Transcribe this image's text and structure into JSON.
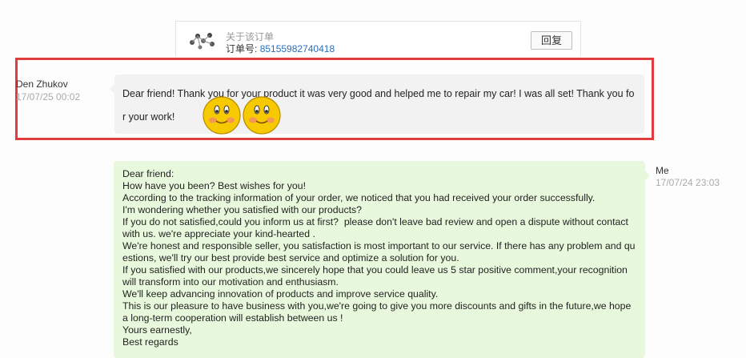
{
  "order": {
    "about_label": "关于该订单",
    "order_no_label": "订单号:",
    "order_no_value": "8515598274041 8",
    "reply_label": "回复"
  },
  "incoming": {
    "sender": "Den Zhukov",
    "time": "17/07/25 00:02",
    "text": "Dear friend! Thank you for your product it was very good and helped me to repair my car! I was all set! Thank you for your work!",
    "emoji": [
      "smiley-face",
      "smiley-face"
    ]
  },
  "outgoing": {
    "sender": "Me",
    "time": "17/07/24 23:03",
    "text": "Dear friend:\nHow have you been? Best wishes for you!\nAccording to the tracking information of your order, we noticed that you had received your order successfully.\nI'm wondering whether you satisfied with our products?\nIf you do not satisfied,could you inform us at first?  please don't leave bad review and open a dispute without contact with us. we're appreciate your kind-hearted .\nWe're honest and responsible seller, you satisfaction is most important to our service. If there has any problem and questions, we'll try our best provide best service and optimize a solution for you.\nIf you satisfied with our products,we sincerely hope that you could leave us 5 star positive comment,your recognition will transform into our motivation and enthusiasm.\nWe'll keep advancing innovation of products and improve service quality.\nThis is our pleasure to have business with you,we're going to give you more discounts and gifts in the future,we hope a long-term cooperation will establish between us !\nYours earnestly,\nBest regards"
  },
  "colors": {
    "highlight": "#e03c3c",
    "incoming_bubble": "#f2f2f2",
    "outgoing_bubble": "#e8f8dc",
    "link": "#2a6ebb"
  }
}
